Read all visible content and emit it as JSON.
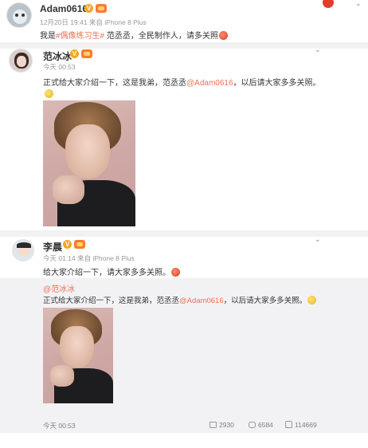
{
  "post1": {
    "username": "Adam0616",
    "meta": "12月20日 19:41 来自 iPhone 8 Plus",
    "text_prefix": "我是",
    "hashtag": "#偶像练习生#",
    "text_suffix": " 范丞丞，全民制作人，请多关照"
  },
  "post2": {
    "username": "范冰冰",
    "meta": "今天 00:53",
    "text_prefix": "正式给大家介绍一下，这是我弟，范丞丞",
    "mention": "@Adam0616",
    "text_suffix": "，以后请大家多多关照。"
  },
  "post3": {
    "username": "李晨",
    "meta": "今天 01:14 来自 iPhone 8 Plus",
    "text": "给大家介绍一下，请大家多多关照。",
    "repost": {
      "author": "@范冰冰",
      "text_prefix": "正式给大家介绍一下，这是我弟，范丞丞",
      "mention": "@Adam0616",
      "text_suffix": "，以后请大家多多关照。"
    },
    "footer": {
      "time": "今天 00:53",
      "reposts": "2930",
      "comments": "6584",
      "likes": "114669"
    }
  },
  "icons": [
    "chevron-down-icon",
    "repost-icon",
    "comment-icon",
    "like-icon"
  ],
  "colors": {
    "link": "#eb7350",
    "badge_v": "#f5a623",
    "badge_level": "#ff7a2f"
  }
}
